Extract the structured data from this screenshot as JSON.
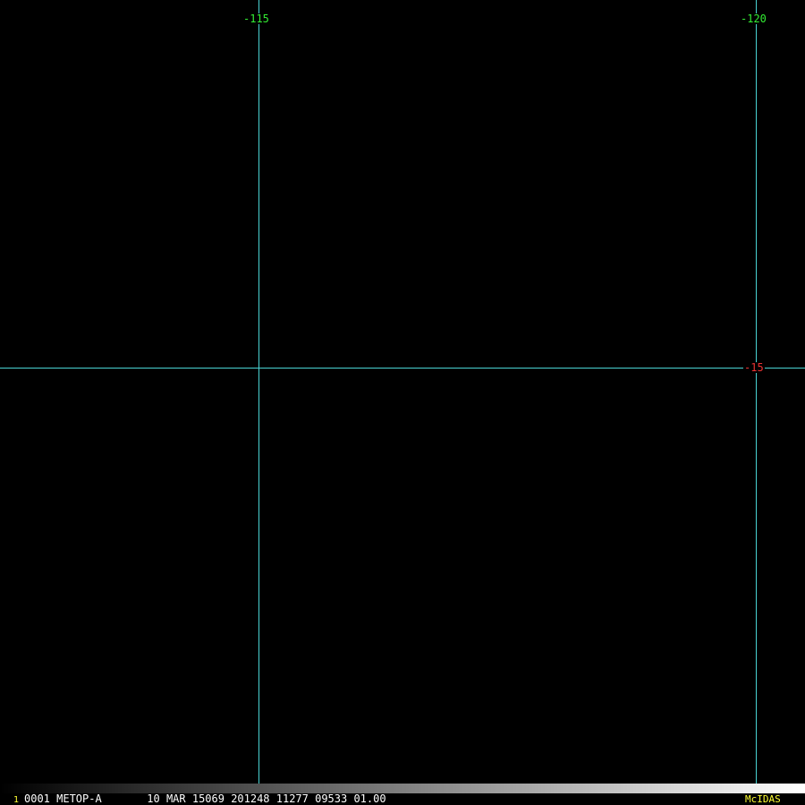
{
  "map": {
    "background_color": "#000000",
    "grid_color": "#4ad4d4",
    "lon_label_color": "#33ee33",
    "lat_label_color": "#ee3333",
    "longitude_labels": [
      "-115",
      "-120"
    ],
    "latitude_labels": [
      "-15"
    ]
  },
  "status_bar": {
    "frame_number": "1",
    "frame_number_color": "#ffff33",
    "image_info": "0001 METOP-A       10 MAR 15069 201248 11277 09533 01.00",
    "brand": "McIDAS",
    "brand_color": "#ffff33",
    "ramp_start_color": "#000000",
    "ramp_end_color": "#ffffff"
  }
}
